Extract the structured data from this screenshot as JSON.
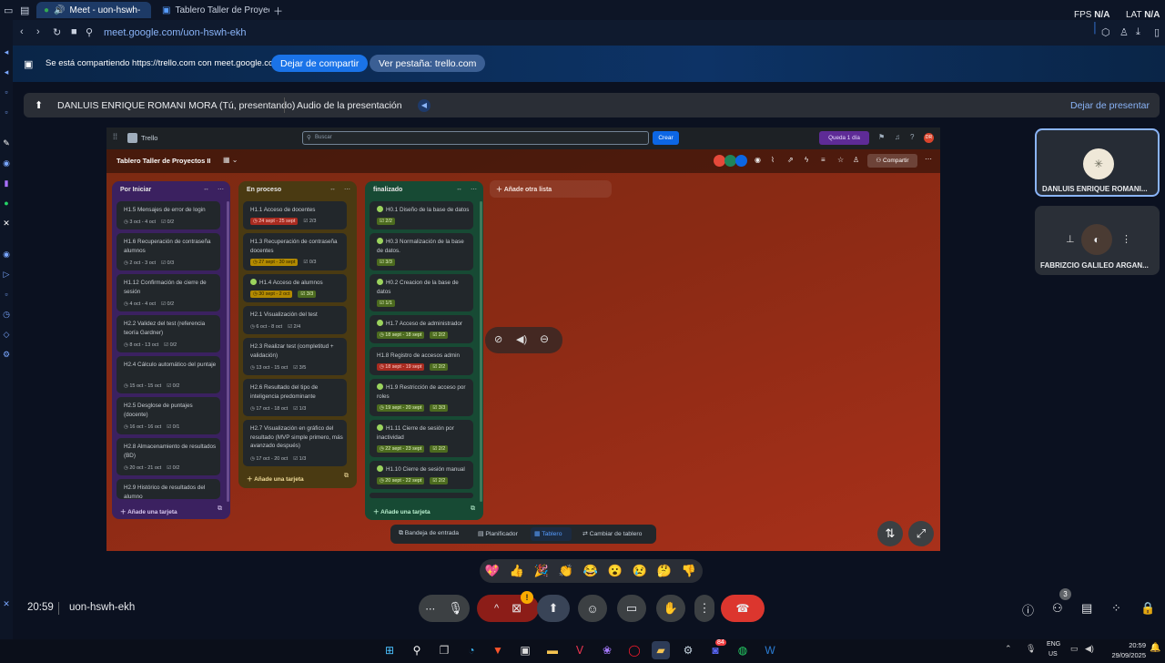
{
  "browser": {
    "tabs": [
      {
        "label": "Meet - uon-hswh-"
      },
      {
        "label": "Tablero Taller de Proyecto"
      }
    ],
    "fps_label": "FPS",
    "fps_value": "N/A",
    "lat_label": "LAT",
    "lat_value": "N/A",
    "url": "meet.google.com/uon-hswh-ekh"
  },
  "share_banner": {
    "message": "Se está compartiendo https://trello.com con meet.google.com",
    "stop_button": "Dejar de compartir",
    "view_tab_button": "Ver pestaña: trello.com"
  },
  "present_bar": {
    "presenter": "DANLUIS ENRIQUE ROMANI MORA (Tú, presentando)",
    "audio_label": "Audio de la presentación",
    "stop_presenting": "Dejar de presentar"
  },
  "trello": {
    "app_name": "Trello",
    "search_placeholder": "Buscar",
    "create_button": "Crear",
    "trial_badge": "Queda 1 día",
    "board_title": "Tablero Taller de Proyectos II",
    "share_button": "Compartir",
    "add_list": "Añade otra lista",
    "add_card": "Añade una tarjeta",
    "lists": [
      {
        "title": "Por Iniciar",
        "cards": [
          {
            "title": "H1.5 Mensajes de error de login",
            "date": "3 oct - 4 oct",
            "checklist": "0/2"
          },
          {
            "title": "H1.6 Recuperación de contraseña alumnos",
            "date": "2 oct - 3 oct",
            "checklist": "0/3"
          },
          {
            "title": "H1.12 Confirmación de cierre de sesión",
            "date": "4 oct - 4 oct",
            "checklist": "0/2"
          },
          {
            "title": "H2.2 Validez del test (referencia teoría Gardner)",
            "date": "8 oct - 13 oct",
            "checklist": "0/2"
          },
          {
            "title": "H2.4 Cálculo automático del puntaje",
            "date": "15 oct - 15 oct",
            "checklist": "0/2"
          },
          {
            "title": "H2.5 Desglose de puntajes (docente)",
            "date": "16 oct - 16 oct",
            "checklist": "0/1"
          },
          {
            "title": "H2.8 Almacenamiento de resultados (BD)",
            "date": "20 oct - 21 oct",
            "checklist": "0/2"
          },
          {
            "title": "H2.9 Histórico de resultados del alumno",
            "date": "",
            "checklist": ""
          }
        ]
      },
      {
        "title": "En proceso",
        "cards": [
          {
            "title": "H1.1 Acceso de docentes",
            "date": "24 sept - 25 sept",
            "checklist": "2/3"
          },
          {
            "title": "H1.3 Recuperación de contraseña docentes",
            "date": "27 sept - 30 sept",
            "checklist": "0/3"
          },
          {
            "title": "H1.4 Acceso de alumnos",
            "date": "30 sept - 2 oct",
            "checklist": "3/3"
          },
          {
            "title": "H2.1 Visualización del test",
            "date": "6 oct - 8 oct",
            "checklist": "2/4"
          },
          {
            "title": "H2.3 Realizar test (completitud + validación)",
            "date": "13 oct - 15 oct",
            "checklist": "3/5"
          },
          {
            "title": "H2.6 Resultado del tipo de inteligencia predominante",
            "date": "17 oct - 18 oct",
            "checklist": "1/3"
          },
          {
            "title": "H2.7 Visualización en gráfico del resultado (MVP simple primero, más avanzado después)",
            "date": "17 oct - 20 oct",
            "checklist": "1/3"
          }
        ]
      },
      {
        "title": "finalizado",
        "cards": [
          {
            "title": "H0.1 Diseño de la base de datos",
            "date": "",
            "checklist": "2/2"
          },
          {
            "title": "H0.3 Normalización de la base de datos.",
            "date": "",
            "checklist": "3/3"
          },
          {
            "title": "H0.2 Creacion de la base de datos",
            "date": "",
            "checklist": "1/1"
          },
          {
            "title": "H1.7 Acceso de administrador",
            "date": "18 sept - 18 sept",
            "checklist": "2/2"
          },
          {
            "title": "H1.8 Registro de accesos admin",
            "date": "18 sept - 19 sept",
            "checklist": "2/2"
          },
          {
            "title": "H1.9 Restricción de acceso por roles",
            "date": "19 sept - 20 sept",
            "checklist": "3/3"
          },
          {
            "title": "H1.11 Cierre de sesión por inactividad",
            "date": "22 sept - 23 sept",
            "checklist": "2/2"
          },
          {
            "title": "H1.10 Cierre de sesión manual",
            "date": "20 sept - 22 sept",
            "checklist": "2/2"
          }
        ]
      }
    ],
    "bottom_nav": [
      {
        "label": "Bandeja de entrada"
      },
      {
        "label": "Planificador"
      },
      {
        "label": "Tablero"
      },
      {
        "label": "Cambiar de tablero"
      }
    ]
  },
  "participants": [
    {
      "name": "DANLUIS ENRIQUE ROMANI..."
    },
    {
      "name": "FABRIZCIO GALILEO ARGAN..."
    }
  ],
  "meeting": {
    "time": "20:59",
    "code": "uon-hswh-ekh",
    "people_count": "3"
  },
  "reactions": [
    "💖",
    "👍",
    "🎉",
    "👏",
    "😂",
    "😮",
    "😢",
    "🤔",
    "👎"
  ],
  "taskbar": {
    "lang_top": "ENG",
    "lang_bottom": "US",
    "clock_time": "20:59",
    "clock_date": "29/09/2025",
    "discord_badge": "84"
  },
  "colors": {
    "accent": "#8ab4f8",
    "end_call": "#dc362e",
    "list_por_iniciar": "#3b2160",
    "list_en_proceso": "#4a3a12",
    "list_finalizado": "#174a34"
  }
}
